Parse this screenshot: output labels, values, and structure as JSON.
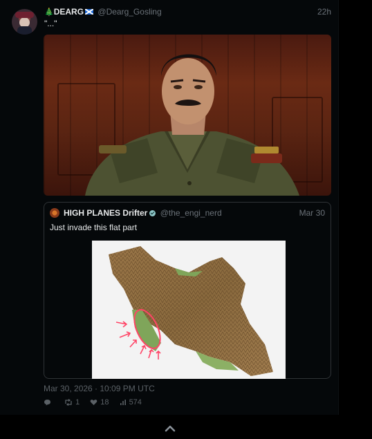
{
  "tweet": {
    "emoji": "🎄",
    "display_name": "DEARG",
    "handle": "@Dearg_Gosling",
    "time": "22h",
    "text": "\"...\"",
    "date": "Mar 30, 2026 · 10:09 PM UTC"
  },
  "quoted": {
    "display_name": "HIGH PLANES Drifter",
    "handle": "@the_engi_nerd",
    "time": "Mar 30",
    "text": "Just invade this flat part"
  },
  "metrics": {
    "replies": "",
    "retweets": "1",
    "likes": "18",
    "views": "574"
  },
  "icons": [
    "avatar",
    "scotland-flag-icon",
    "verified-icon",
    "reply-icon",
    "retweet-icon",
    "like-icon",
    "views-icon",
    "chevron-up-icon"
  ],
  "colors": {
    "background": "#000000",
    "text": "#e7e9ea",
    "muted": "#6b7279",
    "annotation": "#ff4466"
  }
}
